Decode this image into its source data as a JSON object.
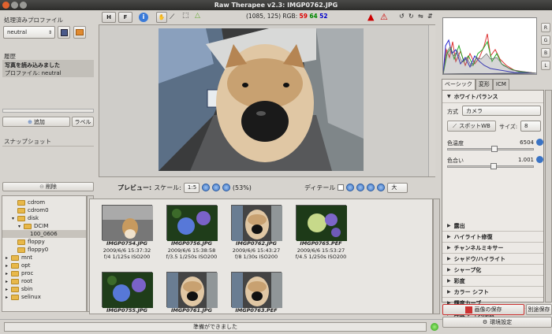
{
  "window": {
    "title": "Raw Therapee v2.3: IMGP0762.JPG"
  },
  "toolbar": {
    "hist_left": "H",
    "hist_right": "F",
    "coords": "(1085, 125)",
    "rgb_label": "RGB:",
    "r": "59",
    "g": "64",
    "b": "52"
  },
  "left": {
    "profile_title": "処理済みプロファイル",
    "profile_value": "neutral",
    "history_title": "履歴",
    "history_items": [
      "写真を読み込みました",
      "プロファイル: neutral"
    ],
    "add_label": "追加",
    "label_label": "ラベル",
    "snapshot_title": "スナップショット",
    "delete_label": "削除"
  },
  "tree": [
    {
      "label": "cdrom",
      "indent": 1
    },
    {
      "label": "cdrom0",
      "indent": 1
    },
    {
      "label": "disk",
      "indent": 1,
      "exp": "▾"
    },
    {
      "label": "DCIM",
      "indent": 2,
      "exp": "▾"
    },
    {
      "label": "100_0606",
      "indent": 3
    },
    {
      "label": "floppy",
      "indent": 1
    },
    {
      "label": "floppy0",
      "indent": 1
    },
    {
      "label": "mnt",
      "indent": 0,
      "exp": "▸"
    },
    {
      "label": "opt",
      "indent": 0,
      "exp": "▸"
    },
    {
      "label": "proc",
      "indent": 0,
      "exp": "▸"
    },
    {
      "label": "root",
      "indent": 0,
      "exp": "▸"
    },
    {
      "label": "sbin",
      "indent": 0,
      "exp": "▸"
    },
    {
      "label": "selinux",
      "indent": 0,
      "exp": "▸"
    }
  ],
  "preview_bar": {
    "preview_label": "プレビュー:",
    "scale_label": "スケール:",
    "scale_value": "1:5",
    "zoom_pct": "(53%)",
    "detail_label": "ディテール",
    "detail_value": "大"
  },
  "thumbs": [
    {
      "name": "IMGP0754.JPG",
      "date": "2009/6/6 15:37:32",
      "exif": "f/4 1/125s ISO200",
      "kind": "dog"
    },
    {
      "name": "IMGP0756.JPG",
      "date": "2009/6/6 15:38:58",
      "exif": "f/3.5 1/250s ISO200",
      "kind": "flower"
    },
    {
      "name": "IMGP0762.JPG",
      "date": "2009/6/6 15:43:27",
      "exif": "f/8 1/30s ISO200",
      "kind": "dogface"
    },
    {
      "name": "IMGP0765.PEF",
      "date": "2009/6/6 15:53:27",
      "exif": "f/4.5 1/250s ISO200",
      "kind": "flower2"
    },
    {
      "name": "IMGP0755.JPG",
      "date": "",
      "exif": "",
      "kind": "flower"
    },
    {
      "name": "IMGP0761.JPG",
      "date": "",
      "exif": "",
      "kind": "dogface"
    },
    {
      "name": "IMGP0763.PEF",
      "date": "",
      "exif": "",
      "kind": "dogface"
    }
  ],
  "status": "準備ができました",
  "right": {
    "tabs": [
      "ベーシック",
      "変形",
      "ICM"
    ],
    "wb_title": "ホワイトバランス",
    "method_label": "方式",
    "method_value": "カメラ",
    "spot_label": "スポットWB",
    "size_label": "サイズ:",
    "size_value": "8",
    "temp_label": "色温度",
    "temp_value": "6504",
    "tint_label": "色合い",
    "tint_value": "1.001",
    "sections": [
      "露出",
      "ハイライト修復",
      "チャンネルミキサー",
      "シャドウ/ハイライト",
      "シャープ化",
      "彩度",
      "カラー シフト",
      "輝度カーブ",
      "輝度 ノイズ除去"
    ],
    "save_label": "画像の保存",
    "queue_label": "別途保存",
    "prefs_label": "環境設定",
    "hist_buttons": [
      "R",
      "G",
      "B",
      "L"
    ]
  }
}
